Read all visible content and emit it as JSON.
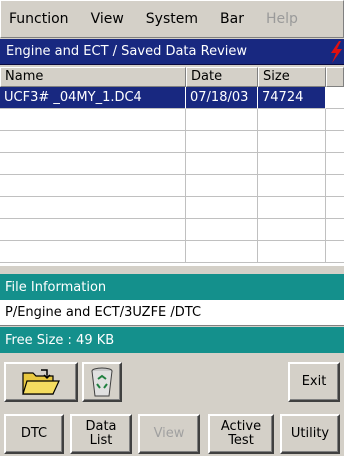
{
  "menu": {
    "items": [
      {
        "label": "Function",
        "enabled": true
      },
      {
        "label": "View",
        "enabled": true
      },
      {
        "label": "System",
        "enabled": true
      },
      {
        "label": "Bar",
        "enabled": true
      },
      {
        "label": "Help",
        "enabled": false
      }
    ]
  },
  "title": "Engine and ECT / Saved Data Review",
  "table": {
    "headers": {
      "name": "Name",
      "date": "Date",
      "size": "Size"
    },
    "rows": [
      {
        "name": "UCF3#  _04MY_1.DC4",
        "date": "07/18/03",
        "size": "74724",
        "selected": true
      }
    ]
  },
  "info": {
    "header": "File Information",
    "path": "P/Engine and ECT/3UZFE /DTC",
    "free": "Free Size : 49 KB"
  },
  "buttons": {
    "folder_icon": "open-folder-icon",
    "recycle_icon": "recycle-bin-icon",
    "exit": "Exit",
    "dtc": "DTC",
    "data_list_1": "Data",
    "data_list_2": "List",
    "view": "View",
    "active_test_1": "Active",
    "active_test_2": "Test",
    "utility": "Utility"
  },
  "colors": {
    "title_bg": "#182880",
    "info_bg": "#14908c",
    "flash": "#e01010"
  }
}
